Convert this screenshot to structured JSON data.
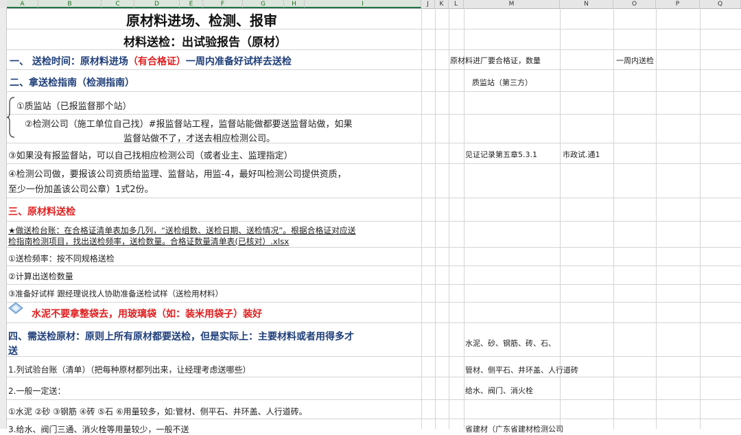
{
  "columns": [
    "A",
    "B",
    "C",
    "D",
    "E",
    "F",
    "G",
    "H",
    "I",
    "J",
    "K",
    "L",
    "M",
    "N",
    "O",
    "P",
    "Q"
  ],
  "title": "原材料进场、检测、报审",
  "subtitle": "材料送检：出试验报告（原材）",
  "section1": {
    "prefix": "一、 送检时间：原材料进场",
    "highlight": "（有合格证）",
    "suffix": "一周内准备好试样去送检"
  },
  "section2": {
    "label": "二、拿送检指南（检测指南）"
  },
  "brace": "{",
  "item1": "①质监站（已报监督那个站）",
  "item2_line1": "②检测公司（施工单位自己找）#报监督站工程，监督站能做都要送监督站做，如果",
  "item2_line2": "监督站做不了，才送去相应检测公司。",
  "item3": "③如果没有报监督站，可以自己找相应检测公司（或者业主、监理指定）",
  "item4_line1": "④检测公司做，要报该公司资质给监理、监督站，用监-4，最好叫检测公司提供资质，",
  "item4_line2": "至少一份加盖该公司公章）1式2份。",
  "section3": {
    "label": "三、原材料送检"
  },
  "link_line1": "★做送检台账：在合格证清单表加多几列，“送检组数、送检日期、送检情况”。根据合格证对应送",
  "link_line2": "检指南检测项目，找出送检频率，送检数量。合格证数量清单表(已核对）.xlsx",
  "step1": "①送检频率：按不同规格送检",
  "step2": "②计算出送检数量",
  "step3": "③准备好试样  跟经理说找人协助准备送检试样（送检用材料）",
  "cement_note": "水泥不要拿整袋去，用玻璃袋（如：装米用袋子）装好",
  "section4_line1": "四、需送检原材：原则上所有原材都要送检，但是实际上：主要材料或者用得多才",
  "section4_line2": "送",
  "list1": "1.列试验台账（清单）（把每种原材都列出来，让经理考虑送哪些）",
  "list2": "2.一般一定送：",
  "list3": "①水泥 ②砂 ③钢筋 ④砖 ⑤石 ⑥用量较多，如:管材、侧平石、井环盖、人行道砖。",
  "list4_partial": "3.给水、阀门三通、消火栓等用量较少，一般不送",
  "side": {
    "r1_l": "原材料进厂要合格证，数量",
    "r1_o": "一周内送检",
    "r2_m": "质监站（第三方）",
    "r6_m": "见证记录第五章5.3.1",
    "r6_n": "市政试.通1",
    "r13_m": "水泥、砂、钢筋、砖、石、",
    "r14_m": "管材、侧平石、井环盖、人行道砖",
    "r15_m": "给水、阀门、消火栓",
    "r17_m": "省建材（广东省建材检测公司"
  },
  "colors": {
    "blue": "#1f3f7a",
    "red": "#e02020",
    "pink": "#c0286a",
    "purple": "#7a2aa0"
  },
  "icons": [
    "diamond-arrows-icon"
  ]
}
